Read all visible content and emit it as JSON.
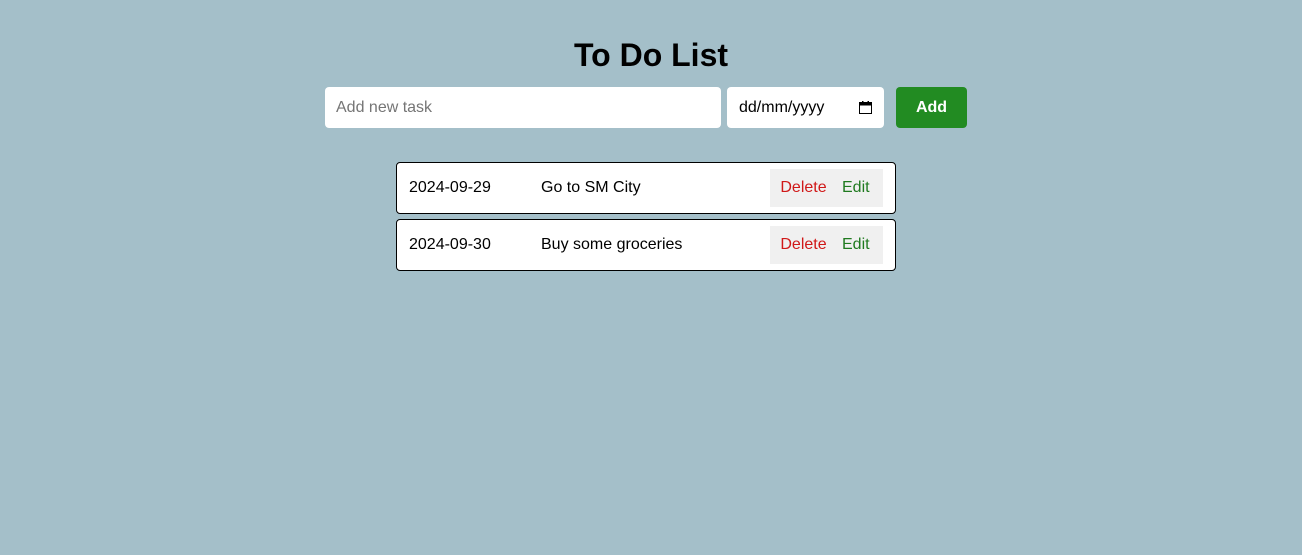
{
  "page": {
    "title": "To Do List"
  },
  "form": {
    "task_placeholder": "Add new task",
    "task_value": "",
    "date_placeholder": "dd/mm/yyyy",
    "add_label": "Add"
  },
  "tasks": [
    {
      "date": "2024-09-29",
      "text": "Go to SM City",
      "delete_label": "Delete",
      "edit_label": "Edit"
    },
    {
      "date": "2024-09-30",
      "text": "Buy some groceries",
      "delete_label": "Delete",
      "edit_label": "Edit"
    }
  ],
  "colors": {
    "background": "#a4bfc9",
    "add_button": "#228b22",
    "delete_text": "#d01818",
    "edit_text": "#1f7a1f"
  },
  "icons": {
    "date_picker": "calendar-icon"
  }
}
